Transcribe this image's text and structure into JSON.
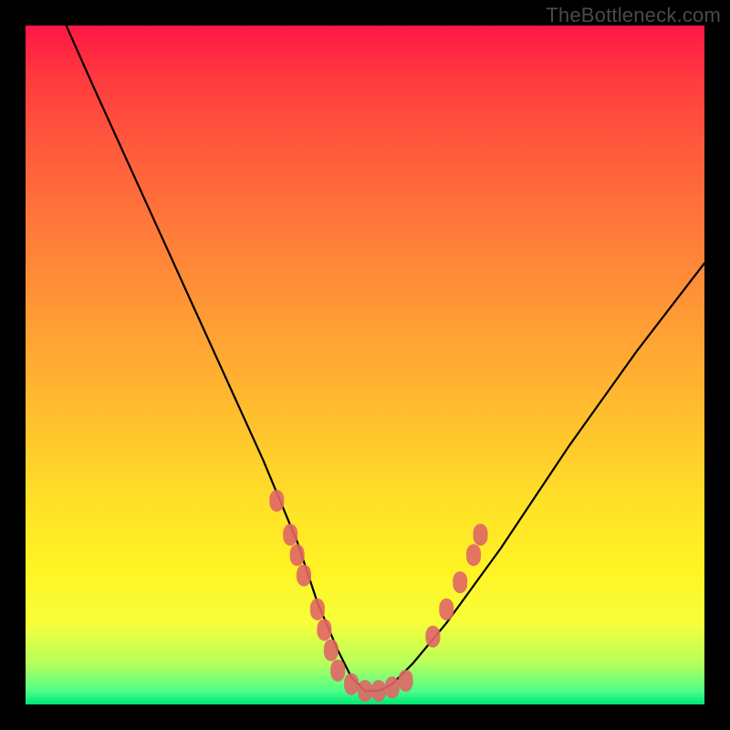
{
  "watermark": "TheBottleneck.com",
  "chart_data": {
    "type": "line",
    "title": "",
    "xlabel": "",
    "ylabel": "",
    "xlim": [
      0,
      100
    ],
    "ylim": [
      0,
      100
    ],
    "series": [
      {
        "name": "curve",
        "x": [
          6,
          10,
          15,
          20,
          25,
          30,
          35,
          40,
          43,
          46,
          48,
          50,
          52,
          54,
          57,
          62,
          70,
          80,
          90,
          100
        ],
        "y": [
          100,
          91,
          80,
          69,
          58,
          47,
          36,
          24,
          15,
          8,
          4,
          2,
          2,
          3,
          6,
          12,
          23,
          38,
          52,
          65
        ]
      }
    ],
    "marker_clusters": [
      {
        "name": "left-cluster",
        "color": "#e06666",
        "points": [
          {
            "x": 37,
            "y": 30
          },
          {
            "x": 39,
            "y": 25
          },
          {
            "x": 40,
            "y": 22
          },
          {
            "x": 41,
            "y": 19
          },
          {
            "x": 43,
            "y": 14
          },
          {
            "x": 44,
            "y": 11
          },
          {
            "x": 45,
            "y": 8
          }
        ]
      },
      {
        "name": "bottom-cluster",
        "color": "#e06666",
        "points": [
          {
            "x": 46,
            "y": 5
          },
          {
            "x": 48,
            "y": 3
          },
          {
            "x": 50,
            "y": 2
          },
          {
            "x": 52,
            "y": 2
          },
          {
            "x": 54,
            "y": 2.5
          },
          {
            "x": 56,
            "y": 3.5
          }
        ]
      },
      {
        "name": "right-cluster",
        "color": "#e06666",
        "points": [
          {
            "x": 60,
            "y": 10
          },
          {
            "x": 62,
            "y": 14
          },
          {
            "x": 64,
            "y": 18
          },
          {
            "x": 66,
            "y": 22
          },
          {
            "x": 67,
            "y": 25
          }
        ]
      }
    ]
  }
}
